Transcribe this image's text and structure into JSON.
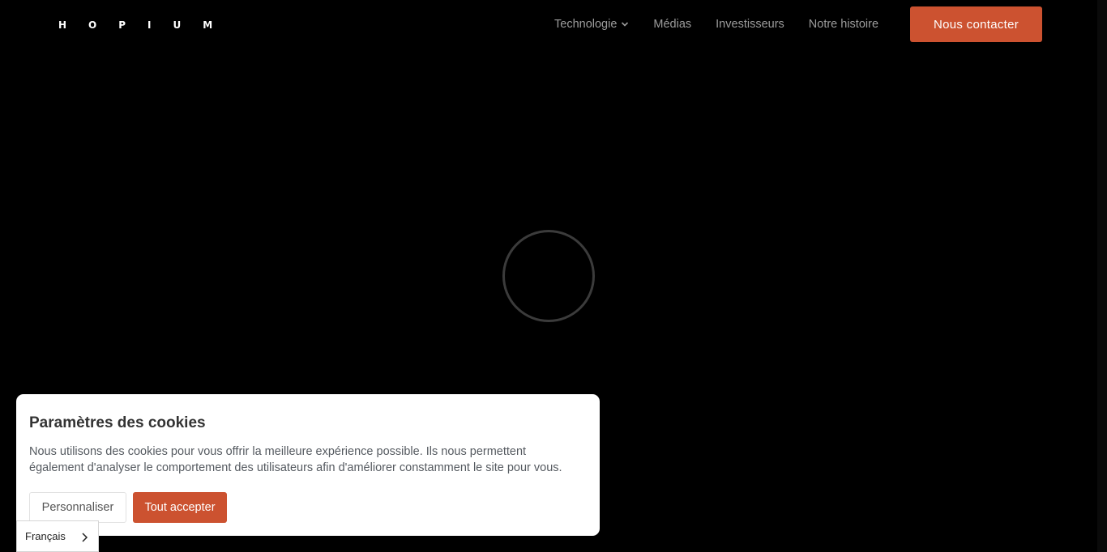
{
  "header": {
    "logo": "HOPIUM",
    "nav": [
      {
        "label": "Technologie",
        "has_dropdown": true
      },
      {
        "label": "Médias"
      },
      {
        "label": "Investisseurs"
      },
      {
        "label": "Notre histoire"
      }
    ],
    "cta_label": "Nous contacter"
  },
  "cookie": {
    "title": "Paramètres des cookies",
    "text": "Nous utilisons des cookies pour vous offrir la meilleure expérience possible. Ils nous permettent également d'analyser le comportement des utilisateurs afin d'améliorer constamment le site pour vous.",
    "customize_label": "Personnaliser",
    "accept_label": "Tout accepter"
  },
  "language": {
    "current": "Français"
  },
  "icons": {
    "dropdown": "chevron-down-icon",
    "language_arrow": "chevron-right-icon",
    "loader": "loading-spinner"
  },
  "colors": {
    "background": "#000000",
    "accent": "#cc5230",
    "nav_text": "#9c9c9c"
  }
}
